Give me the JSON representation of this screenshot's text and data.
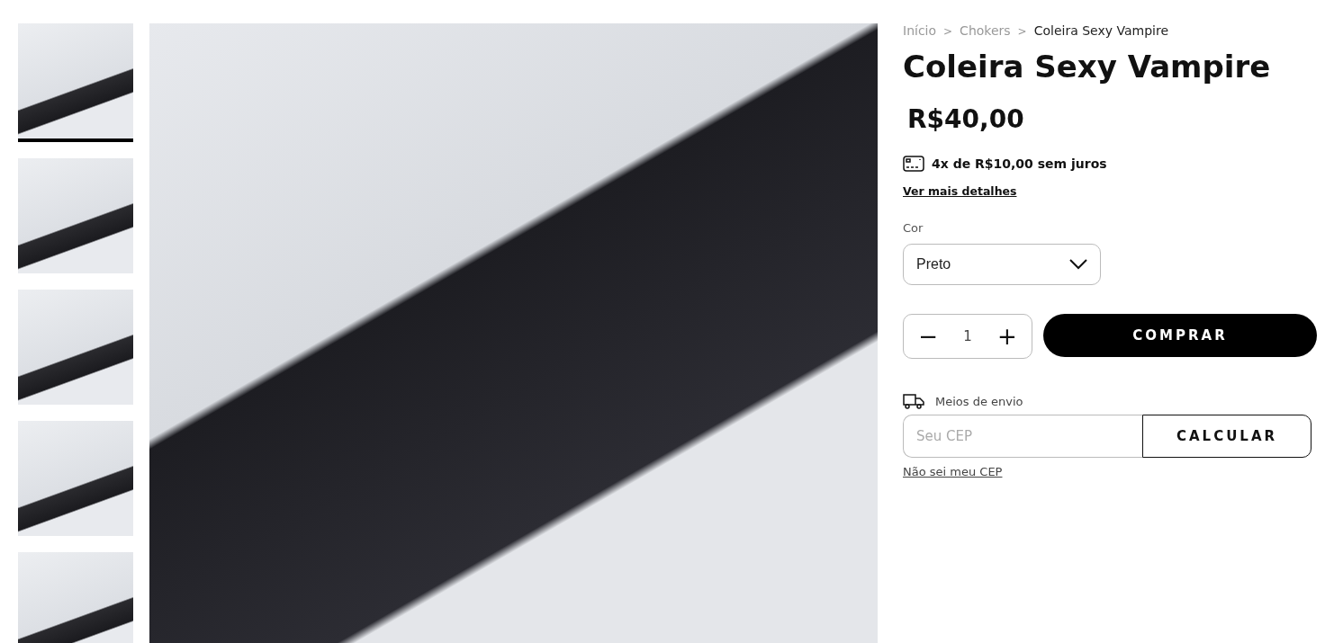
{
  "gallery": {
    "thumbnails": [
      {
        "selected": true
      },
      {
        "selected": false
      },
      {
        "selected": false
      },
      {
        "selected": false
      },
      {
        "selected": false
      }
    ]
  },
  "breadcrumb": {
    "separator": ">",
    "items": [
      {
        "label": "Início",
        "current": false
      },
      {
        "label": "Chokers",
        "current": false
      },
      {
        "label": "Coleira Sexy Vampire",
        "current": true
      }
    ]
  },
  "product": {
    "title": "Coleira Sexy Vampire",
    "price": "R$40,00",
    "installments": "4x de R$10,00 sem juros",
    "details_link": "Ver mais detalhes"
  },
  "variant": {
    "label": "Cor",
    "value": "Preto"
  },
  "quantity": {
    "minus": "−",
    "value": "1",
    "plus": "+"
  },
  "buy_button": "COMPRAR",
  "shipping": {
    "label": "Meios de envio",
    "placeholder": "Seu CEP",
    "button": "CALCULAR",
    "help_link": "Não sei meu CEP"
  }
}
